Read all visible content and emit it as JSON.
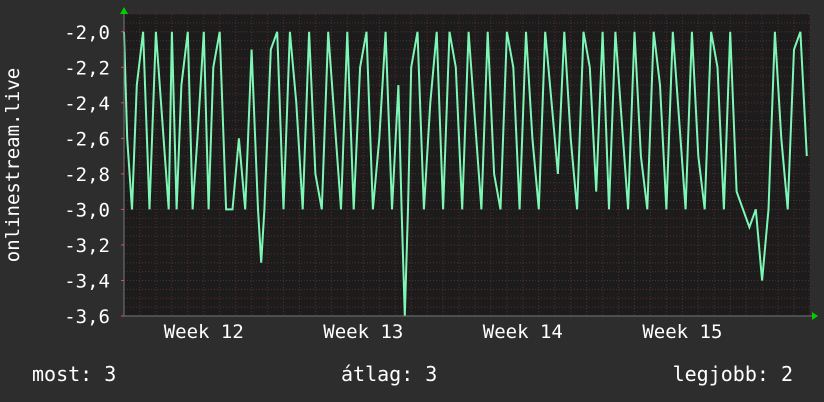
{
  "chart_data": {
    "type": "line",
    "ylabel": "onlinestream.live",
    "xlabel": "",
    "title": "",
    "ylim": [
      -3.6,
      -1.9
    ],
    "grid": true,
    "colors": {
      "background": "#2d2d2d",
      "plot_background": "#1c1c1c",
      "grid": "#5a2a2a",
      "line": "#7ef7b6",
      "axis_arrow": "#00cc00"
    },
    "y_ticks": [
      "-2,0",
      "-2,2",
      "-2,4",
      "-2,6",
      "-2,8",
      "-3,0",
      "-3,2",
      "-3,4",
      "-3,6"
    ],
    "y_tick_values": [
      -2.0,
      -2.2,
      -2.4,
      -2.6,
      -2.8,
      -3.0,
      -3.2,
      -3.4,
      -3.6
    ],
    "x_ticks": [
      "Week 12",
      "Week 13",
      "Week 14",
      "Week 15"
    ],
    "x_tick_values": [
      12,
      13,
      14,
      15
    ],
    "xlim": [
      11.5,
      15.8
    ],
    "series": [
      {
        "values_x": [
          11.5,
          11.52,
          11.55,
          11.58,
          11.62,
          11.66,
          11.7,
          11.74,
          11.78,
          11.8,
          11.83,
          11.86,
          11.9,
          11.93,
          11.96,
          12.0,
          12.03,
          12.06,
          12.1,
          12.14,
          12.18,
          12.22,
          12.26,
          12.3,
          12.34,
          12.36,
          12.38,
          12.42,
          12.46,
          12.5,
          12.54,
          12.58,
          12.62,
          12.66,
          12.7,
          12.74,
          12.78,
          12.82,
          12.86,
          12.9,
          12.94,
          12.98,
          13.02,
          13.06,
          13.1,
          13.14,
          13.18,
          13.22,
          13.24,
          13.26,
          13.28,
          13.3,
          13.34,
          13.38,
          13.42,
          13.46,
          13.5,
          13.54,
          13.58,
          13.62,
          13.66,
          13.7,
          13.74,
          13.78,
          13.82,
          13.86,
          13.9,
          13.94,
          13.98,
          14.02,
          14.06,
          14.1,
          14.14,
          14.18,
          14.22,
          14.26,
          14.3,
          14.34,
          14.38,
          14.42,
          14.46,
          14.5,
          14.54,
          14.58,
          14.62,
          14.66,
          14.7,
          14.74,
          14.78,
          14.82,
          14.86,
          14.9,
          14.94,
          14.98,
          15.02,
          15.06,
          15.1,
          15.14,
          15.18,
          15.22,
          15.26,
          15.3,
          15.34,
          15.38,
          15.42,
          15.46,
          15.5,
          15.54,
          15.58,
          15.62,
          15.66,
          15.7,
          15.74,
          15.78
        ],
        "values_y": [
          -2.0,
          -2.6,
          -3.0,
          -2.3,
          -2.0,
          -3.0,
          -2.0,
          -2.5,
          -3.0,
          -2.0,
          -3.0,
          -2.3,
          -2.0,
          -3.0,
          -2.6,
          -2.0,
          -3.0,
          -2.2,
          -2.0,
          -3.0,
          -3.0,
          -2.6,
          -3.0,
          -2.1,
          -3.0,
          -3.3,
          -3.0,
          -2.1,
          -2.0,
          -3.0,
          -2.0,
          -2.4,
          -3.0,
          -2.0,
          -2.8,
          -3.0,
          -2.0,
          -2.5,
          -3.0,
          -2.0,
          -3.0,
          -2.2,
          -2.0,
          -3.0,
          -2.6,
          -2.0,
          -3.0,
          -2.3,
          -3.0,
          -3.6,
          -3.0,
          -2.2,
          -2.0,
          -3.0,
          -2.4,
          -2.0,
          -3.0,
          -2.0,
          -2.2,
          -3.0,
          -2.0,
          -2.5,
          -3.0,
          -2.0,
          -2.8,
          -3.0,
          -2.0,
          -2.2,
          -3.0,
          -2.0,
          -2.6,
          -3.0,
          -2.0,
          -2.4,
          -2.8,
          -2.0,
          -2.6,
          -3.0,
          -2.0,
          -2.2,
          -2.9,
          -2.0,
          -3.0,
          -2.0,
          -2.5,
          -3.0,
          -2.0,
          -2.7,
          -3.0,
          -2.0,
          -2.3,
          -3.0,
          -2.0,
          -2.5,
          -3.0,
          -2.0,
          -2.7,
          -3.0,
          -2.0,
          -2.2,
          -3.0,
          -2.0,
          -2.9,
          -3.0,
          -3.1,
          -3.0,
          -3.4,
          -3.0,
          -2.0,
          -2.6,
          -3.0,
          -2.1,
          -2.0,
          -2.7
        ]
      }
    ]
  },
  "stats": {
    "now": "most: 3",
    "avg": "átlag: 3",
    "max": "legjobb: 2"
  }
}
